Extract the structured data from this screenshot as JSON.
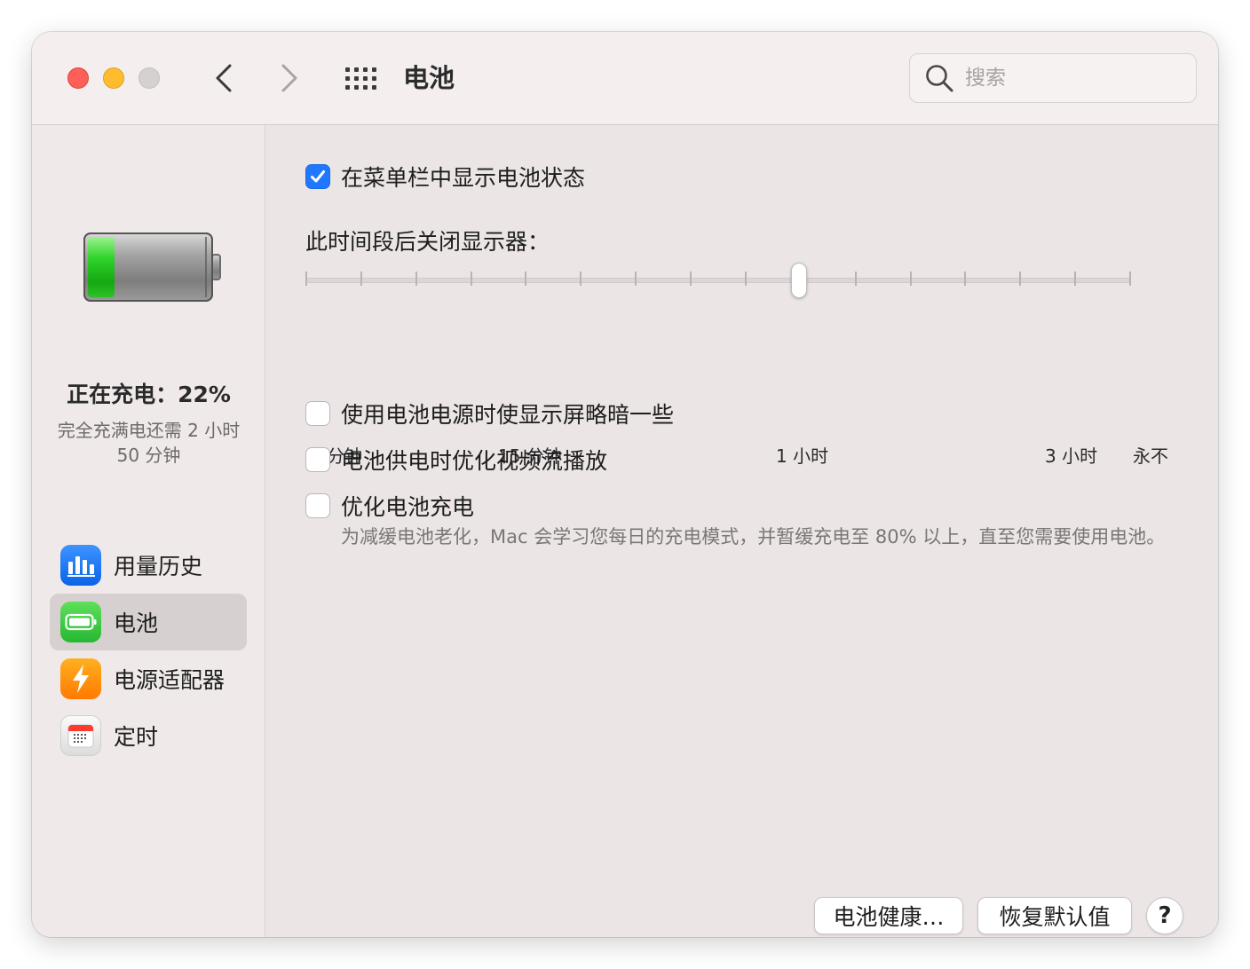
{
  "window": {
    "title": "电池"
  },
  "search": {
    "placeholder": "搜索",
    "value": ""
  },
  "sidebar": {
    "charge_status": "正在充电：22%",
    "charge_remaining": "完全充满电还需 2 小时 50 分钟",
    "battery_level": 0.22,
    "items": [
      {
        "label": "用量历史",
        "icon": "usage-history-icon",
        "color": "#1a7cff",
        "selected": false
      },
      {
        "label": "电池",
        "icon": "battery-icon",
        "color": "#34c759",
        "selected": true
      },
      {
        "label": "电源适配器",
        "icon": "power-adapter-icon",
        "color": "#ff9500",
        "selected": false
      },
      {
        "label": "定时",
        "icon": "calendar-schedule-icon",
        "color": "#ffffff",
        "selected": false
      }
    ]
  },
  "main": {
    "show_battery_status": {
      "label": "在菜单栏中显示电池状态",
      "checked": true
    },
    "display_off": {
      "title": "此时间段后关闭显示器：",
      "labels": [
        "1 分钟",
        "15 分钟",
        "1 小时",
        "3 小时",
        "永不"
      ],
      "selected": "1 小时"
    },
    "dim_display": {
      "label": "使用电池电源时使显示屏略暗一些",
      "checked": false
    },
    "optimize_video": {
      "label": "电池供电时优化视频流播放",
      "checked": false
    },
    "optimize_charging": {
      "label": "优化电池充电",
      "checked": false,
      "description": "为减缓电池老化，Mac 会学习您每日的充电模式，并暂缓充电至 80% 以上，直至您需要使用电池。"
    }
  },
  "footer": {
    "battery_health_label": "电池健康…",
    "restore_defaults_label": "恢复默认值",
    "help_label": "?"
  },
  "colors": {
    "accent": "#1f78ff",
    "battery_green": "#34c759",
    "close": "#fe5f57",
    "minimize": "#febc2e"
  }
}
